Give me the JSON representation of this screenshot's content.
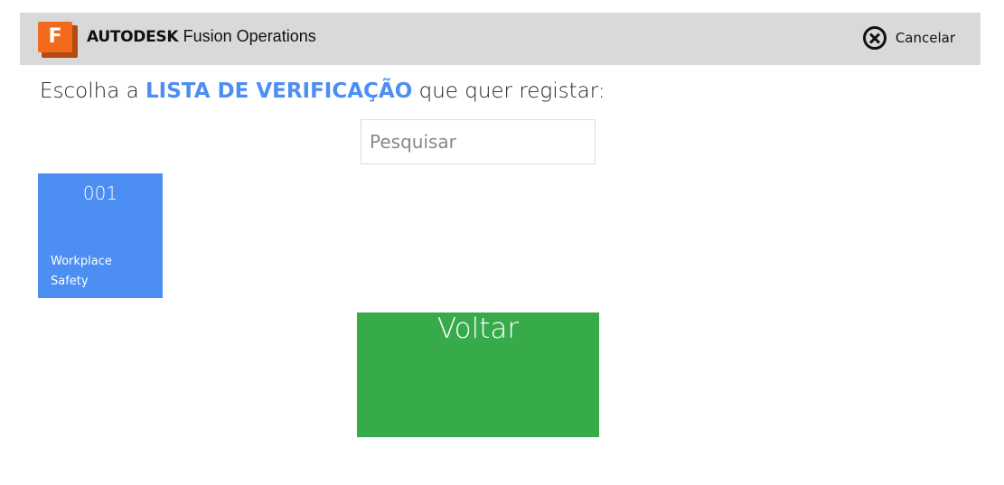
{
  "header": {
    "logo_letter": "F",
    "brand_bold": "AUTODESK",
    "brand_product": "Fusion Operations",
    "cancel_label": "Cancelar"
  },
  "prompt": {
    "before": "Escolha a ",
    "highlight": "LISTA DE VERIFICAÇÃO",
    "after": " que quer registar:"
  },
  "search": {
    "placeholder": "Pesquisar",
    "value": ""
  },
  "checklists": [
    {
      "code": "001",
      "name": "Workplace Safety"
    }
  ],
  "back_button": {
    "label": "Voltar"
  },
  "colors": {
    "header_bg": "#d9d9d9",
    "brand_orange": "#f26b1d",
    "accent_blue": "#4d8ef3",
    "back_green": "#37aa4a"
  },
  "icons": {
    "logo": "fusion-logo-icon",
    "cancel": "close-circle-icon"
  }
}
